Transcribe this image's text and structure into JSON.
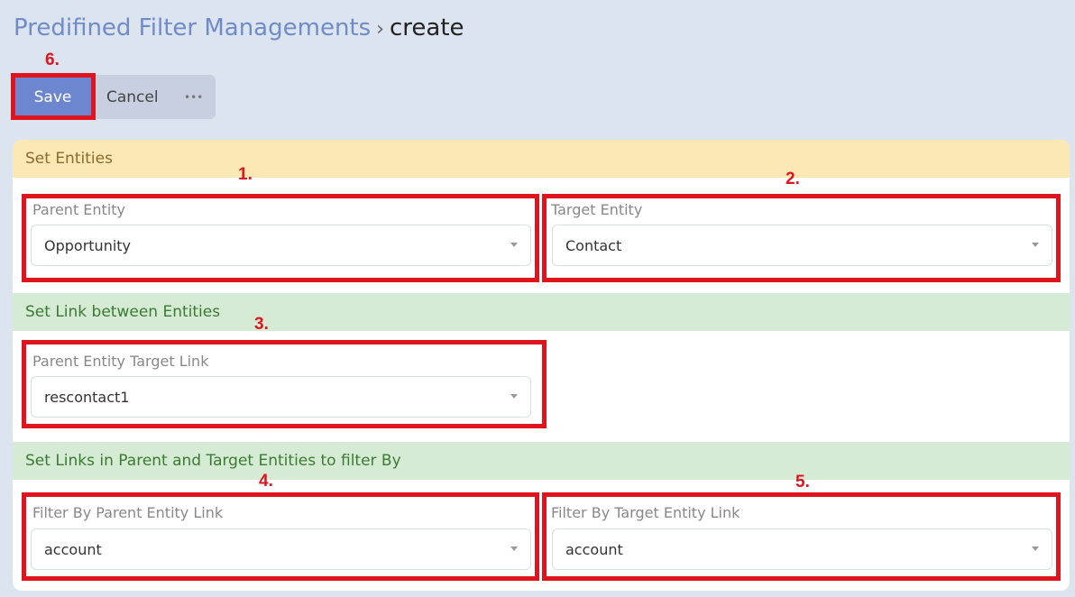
{
  "breadcrumb": {
    "link": "Predifined Filter Managements",
    "separator": "›",
    "current": "create"
  },
  "toolbar": {
    "save_label": "Save",
    "cancel_label": "Cancel",
    "more_label": "•••"
  },
  "sections": {
    "entities": {
      "title": "Set Entities"
    },
    "link": {
      "title": "Set Link between Entities"
    },
    "filter_links": {
      "title": "Set Links in Parent and Target Entities to filter By"
    }
  },
  "fields": {
    "parent_entity": {
      "label": "Parent Entity",
      "value": "Opportunity"
    },
    "target_entity": {
      "label": "Target Entity",
      "value": "Contact"
    },
    "parent_target_link": {
      "label": "Parent Entity Target Link",
      "value": "rescontact1"
    },
    "filter_parent_link": {
      "label": "Filter By Parent Entity Link",
      "value": "account"
    },
    "filter_target_link": {
      "label": "Filter By Target Entity Link",
      "value": "account"
    }
  },
  "annotations": {
    "n1": "1.",
    "n2": "2.",
    "n3": "3.",
    "n4": "4.",
    "n5": "5.",
    "n6": "6."
  },
  "colors": {
    "accent": "#6c86cf",
    "annotation_red": "#e0141e",
    "section_yellow": "#fbe8b4",
    "section_green": "#d6ebd3"
  }
}
